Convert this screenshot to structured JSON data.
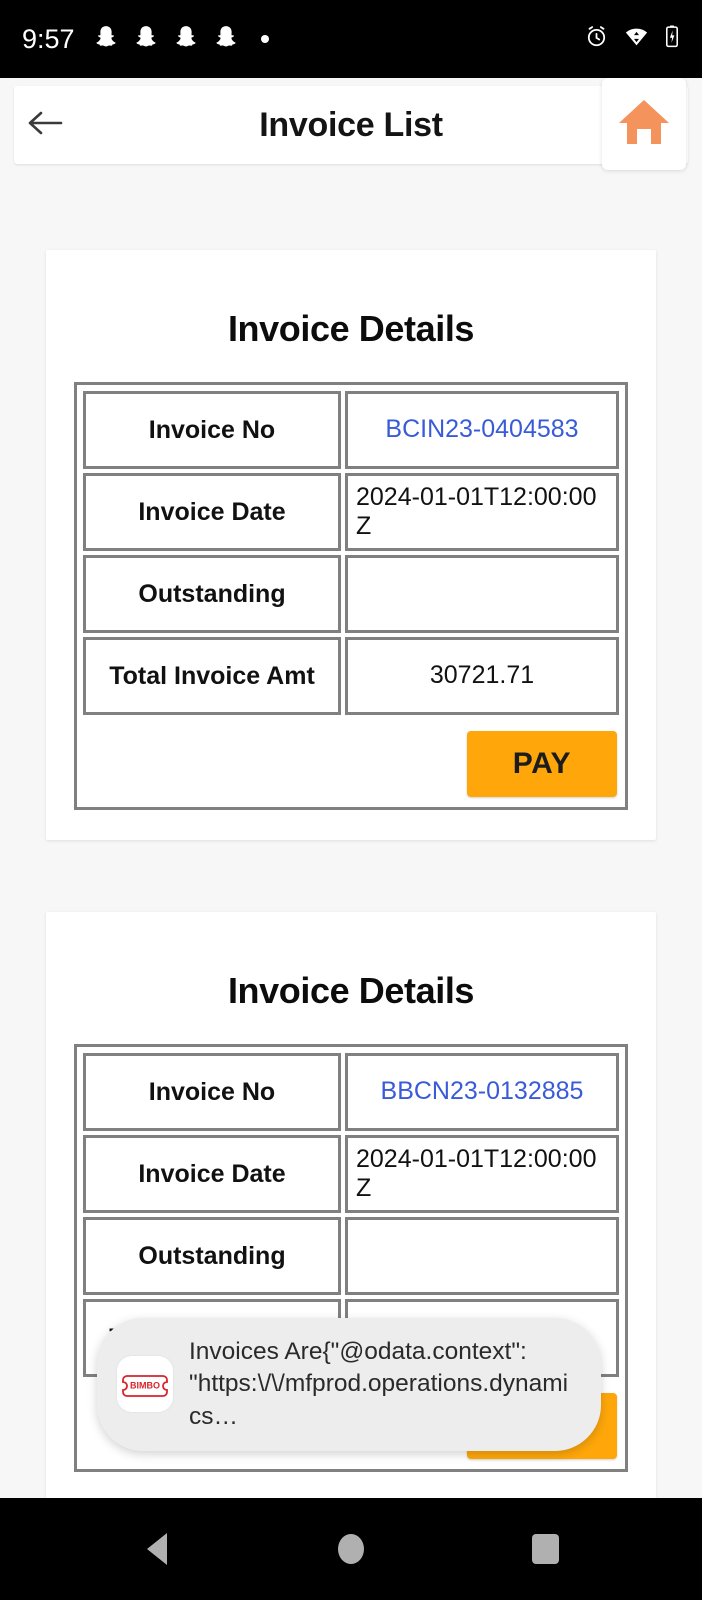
{
  "status_bar": {
    "time": "9:57",
    "left_icons": [
      "ghost-icon",
      "ghost-icon",
      "ghost-icon",
      "ghost-icon",
      "dot-icon"
    ],
    "right_icons": [
      "alarm-icon",
      "wifi-icon",
      "battery-icon"
    ]
  },
  "header": {
    "back_icon": "back-arrow-icon",
    "title": "Invoice List",
    "home_icon": "home-icon",
    "accent_color": "#F5935C"
  },
  "labels": {
    "invoice_no": "Invoice No",
    "invoice_date": "Invoice Date",
    "outstanding": "Outstanding",
    "total_invoice_amt": "Total Invoice Amt",
    "pay": "PAY"
  },
  "cards": [
    {
      "title": "Invoice Details",
      "invoice_no": "BCIN23-0404583",
      "invoice_date": "2024-01-01T12:00:00Z",
      "outstanding": "",
      "total_invoice_amt": "30721.71",
      "pay_label": "PAY"
    },
    {
      "title": "Invoice Details",
      "invoice_no": "BBCN23-0132885",
      "invoice_date": "2024-01-01T12:00:00Z",
      "outstanding": "",
      "total_invoice_amt": "",
      "pay_label": "PAY"
    }
  ],
  "toast": {
    "app_icon_label": "BIMBO",
    "message": "Invoices Are{\"@odata.context\": \"https:\\/\\/mfprod.operations.dynamics…"
  },
  "nav_bar": {
    "back_icon": "nav-back-icon",
    "home_icon": "nav-home-icon",
    "recents_icon": "nav-recents-icon"
  },
  "colors": {
    "pay_button": "#FFA70A",
    "invoice_link": "#3A5BD9",
    "table_border": "#808080",
    "page_background": "#F7F7F7"
  }
}
